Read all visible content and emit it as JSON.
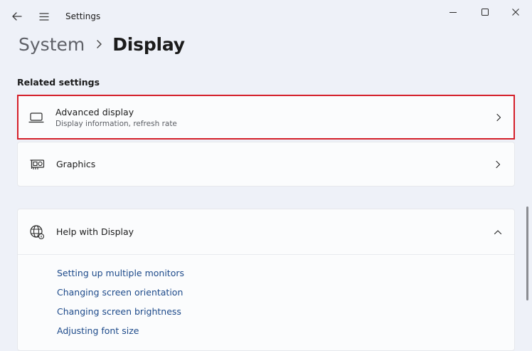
{
  "window": {
    "app_title": "Settings"
  },
  "breadcrumb": {
    "parent": "System",
    "current": "Display"
  },
  "related_settings": {
    "heading": "Related settings",
    "items": [
      {
        "title": "Advanced display",
        "subtitle": "Display information, refresh rate",
        "icon": "laptop-icon",
        "highlighted": true
      },
      {
        "title": "Graphics",
        "icon": "graphics-card-icon"
      }
    ]
  },
  "help": {
    "title": "Help with Display",
    "icon": "globe-icon",
    "expanded": true,
    "links": [
      "Setting up multiple monitors",
      "Changing screen orientation",
      "Changing screen brightness",
      "Adjusting font size"
    ]
  },
  "colors": {
    "highlight_border": "#d41f2a",
    "link": "#1d4a8a",
    "background": "#eef1f8"
  }
}
